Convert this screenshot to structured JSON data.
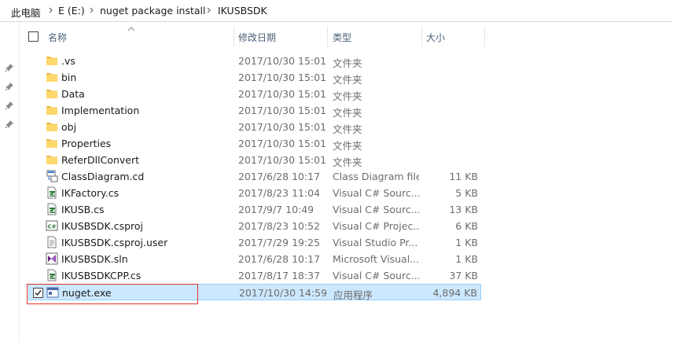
{
  "breadcrumb": {
    "items": [
      "此电脑",
      "E (E:)",
      "nuget package install",
      "IKUSBSDK"
    ]
  },
  "columns": {
    "name": "名称",
    "date": "修改日期",
    "type": "类型",
    "size": "大小"
  },
  "files": [
    {
      "name": ".vs",
      "date": "2017/10/30 15:01",
      "type": "文件夹",
      "size": "",
      "icon": "folder-icon"
    },
    {
      "name": "bin",
      "date": "2017/10/30 15:01",
      "type": "文件夹",
      "size": "",
      "icon": "folder-icon"
    },
    {
      "name": "Data",
      "date": "2017/10/30 15:01",
      "type": "文件夹",
      "size": "",
      "icon": "folder-icon"
    },
    {
      "name": "Implementation",
      "date": "2017/10/30 15:01",
      "type": "文件夹",
      "size": "",
      "icon": "folder-icon"
    },
    {
      "name": "obj",
      "date": "2017/10/30 15:01",
      "type": "文件夹",
      "size": "",
      "icon": "folder-icon"
    },
    {
      "name": "Properties",
      "date": "2017/10/30 15:01",
      "type": "文件夹",
      "size": "",
      "icon": "folder-icon"
    },
    {
      "name": "ReferDllConvert",
      "date": "2017/10/30 15:01",
      "type": "文件夹",
      "size": "",
      "icon": "folder-icon"
    },
    {
      "name": "ClassDiagram.cd",
      "date": "2017/6/28 10:17",
      "type": "Class Diagram file",
      "size": "11 KB",
      "icon": "class-diagram-icon"
    },
    {
      "name": "IKFactory.cs",
      "date": "2017/8/23 11:04",
      "type": "Visual C# Sourc...",
      "size": "5 KB",
      "icon": "csharp-source-icon"
    },
    {
      "name": "IKUSB.cs",
      "date": "2017/9/7 10:49",
      "type": "Visual C# Sourc...",
      "size": "13 KB",
      "icon": "csharp-source-icon"
    },
    {
      "name": "IKUSBSDK.csproj",
      "date": "2017/8/23 10:52",
      "type": "Visual C# Projec...",
      "size": "6 KB",
      "icon": "csharp-project-icon"
    },
    {
      "name": "IKUSBSDK.csproj.user",
      "date": "2017/7/29 19:25",
      "type": "Visual Studio Pr...",
      "size": "1 KB",
      "icon": "user-file-icon"
    },
    {
      "name": "IKUSBSDK.sln",
      "date": "2017/6/28 10:17",
      "type": "Microsoft Visual...",
      "size": "1 KB",
      "icon": "solution-icon"
    },
    {
      "name": "IKUSBSDKCPP.cs",
      "date": "2017/8/17 18:37",
      "type": "Visual C# Sourc...",
      "size": "37 KB",
      "icon": "csharp-source-icon"
    },
    {
      "name": "nuget.exe",
      "date": "2017/10/30 14:59",
      "type": "应用程序",
      "size": "4,894 KB",
      "icon": "exe-icon",
      "selected": true
    }
  ],
  "colors": {
    "selection_bg": "#cce8ff",
    "selection_border": "#99d1ff",
    "highlight_box": "#e0302b",
    "folder": "#ffd86b",
    "header_text": "#4c607a"
  }
}
